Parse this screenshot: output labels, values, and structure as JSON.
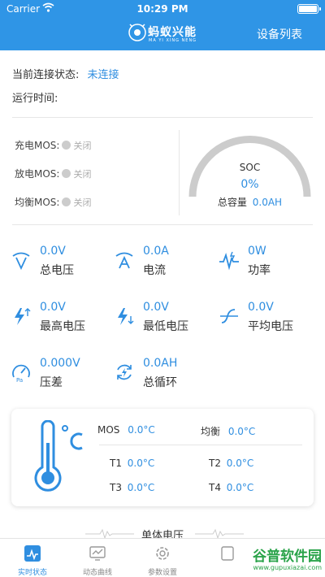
{
  "status_bar": {
    "carrier": "Carrier",
    "time": "10:29 PM"
  },
  "navbar": {
    "brand": "蚂蚁兴能",
    "brand_sub": "MA YI XING NENG",
    "device_list": "设备列表"
  },
  "connection": {
    "label": "当前连接状态:",
    "value": "未连接"
  },
  "runtime": {
    "label": "运行时间:"
  },
  "mos": [
    {
      "label": "充电MOS:",
      "state": "关闭"
    },
    {
      "label": "放电MOS:",
      "state": "关闭"
    },
    {
      "label": "均衡MOS:",
      "state": "关闭"
    }
  ],
  "soc": {
    "title": "SOC",
    "value": "0%",
    "capacity_label": "总容量",
    "capacity_value": "0.0AH"
  },
  "metrics": [
    {
      "value": "0.0V",
      "label": "总电压",
      "icon": "total-voltage-icon"
    },
    {
      "value": "0.0A",
      "label": "电流",
      "icon": "current-icon"
    },
    {
      "value": "0W",
      "label": "功率",
      "icon": "power-icon"
    },
    {
      "value": "0.0V",
      "label": "最高电压",
      "icon": "max-voltage-icon"
    },
    {
      "value": "0.0V",
      "label": "最低电压",
      "icon": "min-voltage-icon"
    },
    {
      "value": "0.0V",
      "label": "平均电压",
      "icon": "avg-voltage-icon"
    },
    {
      "value": "0.000V",
      "label": "压差",
      "icon": "pressure-diff-icon"
    },
    {
      "value": "0.0AH",
      "label": "总循环",
      "icon": "cycle-icon"
    }
  ],
  "temperature": {
    "unit": "°C",
    "mos": {
      "label": "MOS",
      "value": "0.0°C"
    },
    "balance": {
      "label": "均衡",
      "value": "0.0°C"
    },
    "t1": {
      "label": "T1",
      "value": "0.0°C"
    },
    "t2": {
      "label": "T2",
      "value": "0.0°C"
    },
    "t3": {
      "label": "T3",
      "value": "0.0°C"
    },
    "t4": {
      "label": "T4",
      "value": "0.0°C"
    }
  },
  "cell_voltage": {
    "title": "单体电压"
  },
  "tabs": [
    {
      "label": "实时状态",
      "icon": "realtime-status-icon",
      "active": true
    },
    {
      "label": "动态曲线",
      "icon": "dynamic-curve-icon",
      "active": false
    },
    {
      "label": "参数设置",
      "icon": "settings-gear-icon",
      "active": false
    }
  ],
  "watermark": {
    "main": "谷普软件园",
    "url": "www.gupuxiazai.com"
  },
  "colors": {
    "primary": "#2f95e6",
    "accent_text": "#2f8ee0",
    "gauge_track": "#cccccc",
    "watermark": "#2aa34a"
  }
}
